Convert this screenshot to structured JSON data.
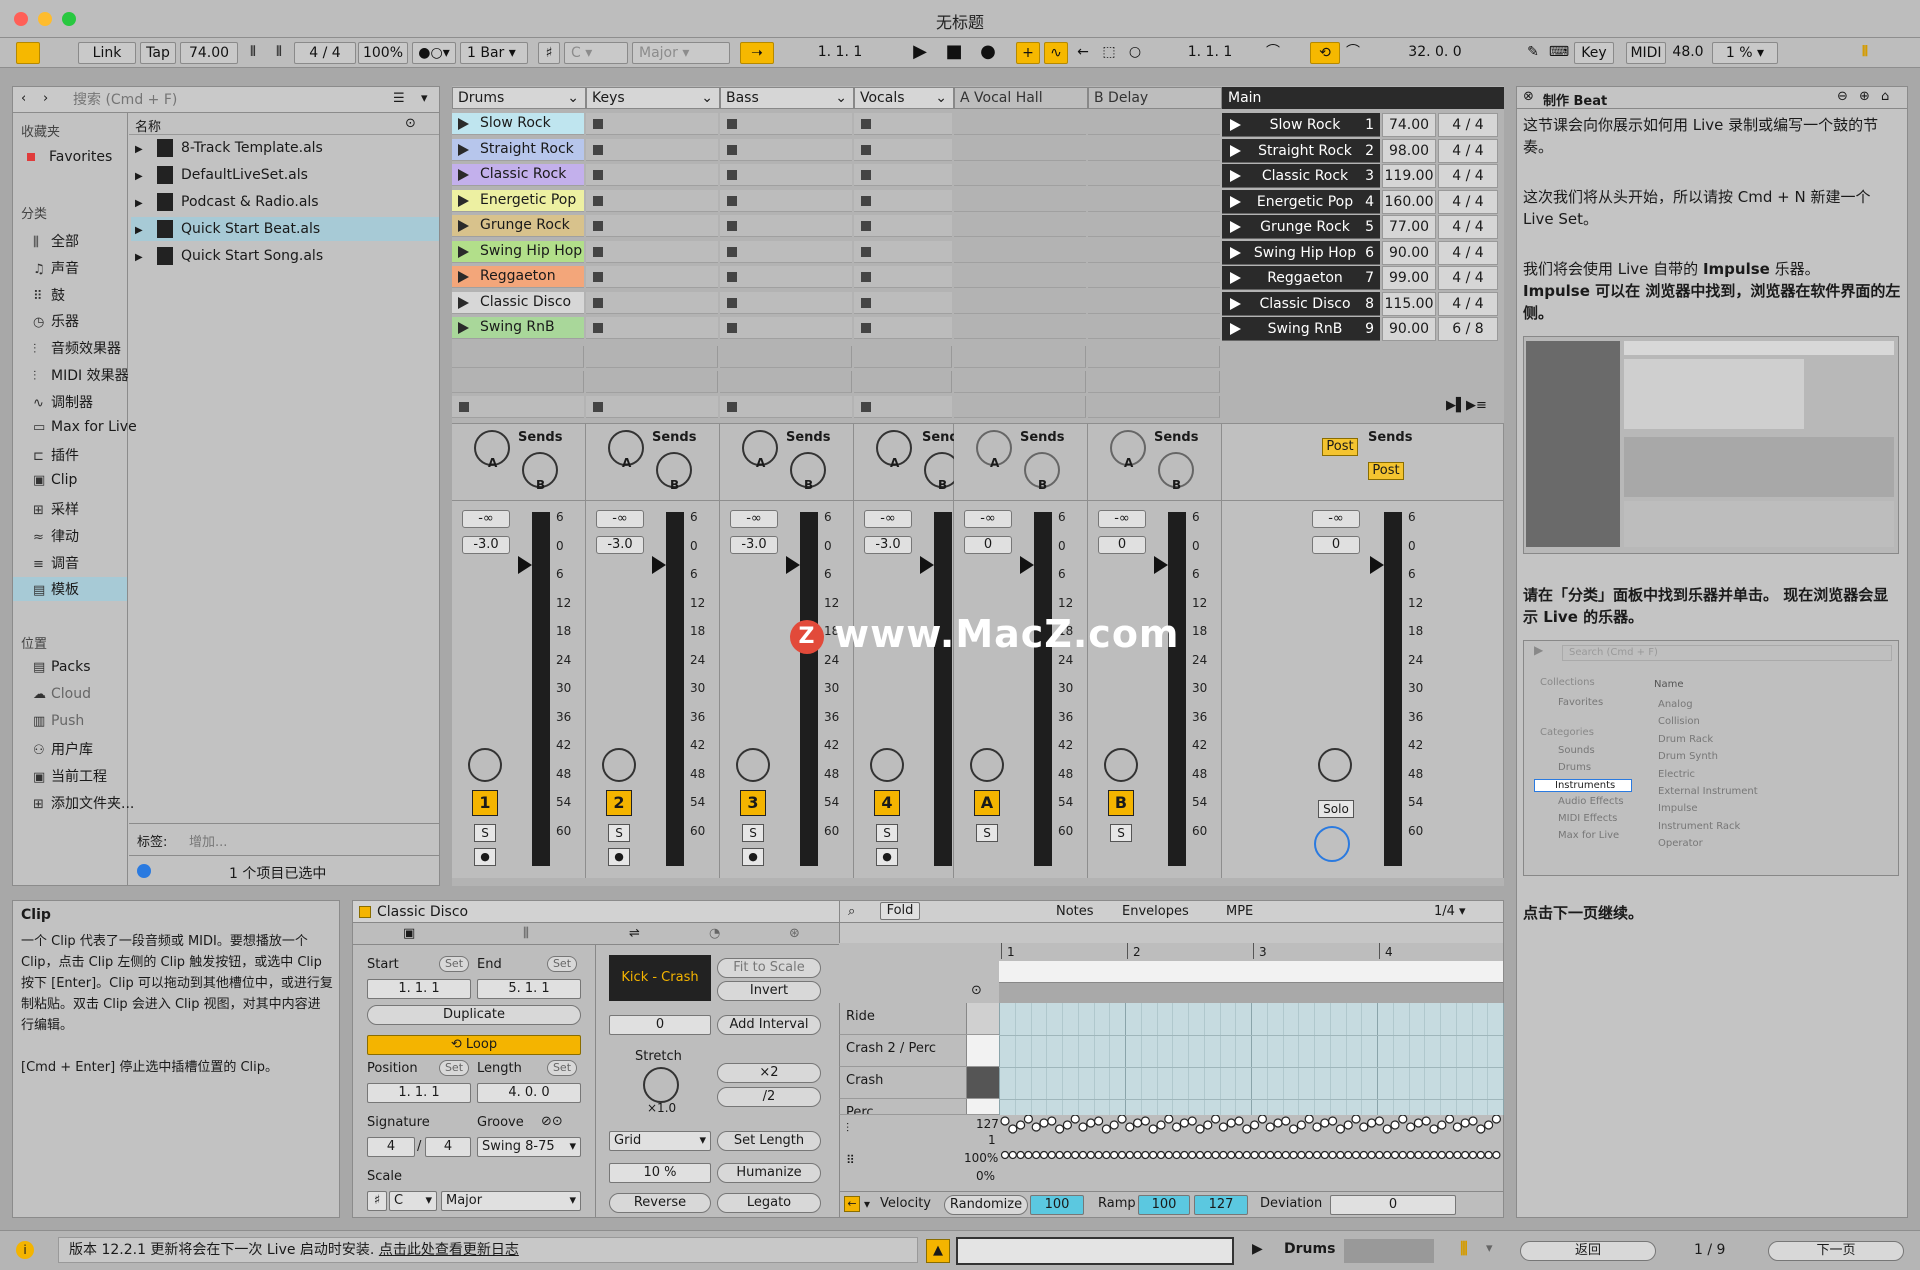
{
  "window": {
    "title": "无标题"
  },
  "toolbar": {
    "link": "Link",
    "tap": "Tap",
    "tempo": "74.00",
    "signature": "4 / 4",
    "zoom": "100%",
    "quantize": "1 Bar",
    "key_root": "C",
    "key_scale": "Major",
    "position": "1.   1.   1",
    "loop_start": "1.   1.   1",
    "loop_length": "32.   0.   0",
    "key_label": "Key",
    "midi_label": "MIDI",
    "sample_rate": "48.0",
    "cpu": "1 %"
  },
  "browser": {
    "search_placeholder": "搜索 (Cmd + F)",
    "favorites_header": "收藏夹",
    "favorites": "Favorites",
    "categories_header": "分类",
    "categories": [
      "全部",
      "声音",
      "鼓",
      "乐器",
      "音频效果器",
      "MIDI 效果器",
      "调制器",
      "Max for Live",
      "插件",
      "Clip",
      "采样",
      "律动",
      "调音",
      "模板"
    ],
    "places_header": "位置",
    "places": [
      "Packs",
      "Cloud",
      "Push",
      "用户库",
      "当前工程",
      "添加文件夹..."
    ],
    "name_header": "名称",
    "files": [
      "8-Track Template.als",
      "DefaultLiveSet.als",
      "Podcast & Radio.als",
      "Quick Start Beat.als",
      "Quick Start Song.als"
    ],
    "tags_label": "标签:",
    "tags_placeholder": "增加...",
    "selection_status": "1 个项目已选中"
  },
  "tracks": [
    {
      "name": "Drums",
      "num": "1",
      "volume": "-3.0"
    },
    {
      "name": "Keys",
      "num": "2",
      "volume": "-3.0"
    },
    {
      "name": "Bass",
      "num": "3",
      "volume": "-3.0"
    },
    {
      "name": "Vocals",
      "num": "4",
      "volume": "-3.0"
    },
    {
      "name": "A Vocal Hall",
      "num": "A",
      "volume": "0"
    },
    {
      "name": "B Delay",
      "num": "B",
      "volume": "0"
    }
  ],
  "main_track": {
    "name": "Main",
    "volume": "0",
    "solo": "Solo"
  },
  "clips": [
    "Slow Rock",
    "Straight Rock",
    "Classic Rock",
    "Energetic Pop",
    "Grunge Rock",
    "Swing Hip Hop",
    "Reggaeton",
    "Classic Disco",
    "Swing RnB"
  ],
  "clip_colors": [
    "#bfe5ef",
    "#b7c6ec",
    "#c3b0ec",
    "#edf0a2",
    "#d8c28c",
    "#b2df8a",
    "#f3a67a",
    "#d7d7d7",
    "#a9d79a"
  ],
  "scenes": [
    {
      "name": "Slow Rock",
      "num": "1",
      "tempo": "74.00",
      "sig": "4 / 4"
    },
    {
      "name": "Straight Rock",
      "num": "2",
      "tempo": "98.00",
      "sig": "4 / 4"
    },
    {
      "name": "Classic Rock",
      "num": "3",
      "tempo": "119.00",
      "sig": "4 / 4"
    },
    {
      "name": "Energetic Pop",
      "num": "4",
      "tempo": "160.00",
      "sig": "4 / 4"
    },
    {
      "name": "Grunge Rock",
      "num": "5",
      "tempo": "77.00",
      "sig": "4 / 4"
    },
    {
      "name": "Swing Hip Hop",
      "num": "6",
      "tempo": "90.00",
      "sig": "4 / 4"
    },
    {
      "name": "Reggaeton",
      "num": "7",
      "tempo": "99.00",
      "sig": "4 / 4"
    },
    {
      "name": "Classic Disco",
      "num": "8",
      "tempo": "115.00",
      "sig": "4 / 4"
    },
    {
      "name": "Swing RnB",
      "num": "9",
      "tempo": "90.00",
      "sig": "6 / 8"
    }
  ],
  "mixer": {
    "sends_label": "Sends",
    "send_a": "A",
    "send_b": "B",
    "post_label": "Post",
    "neg_inf": "-∞",
    "solo_btn": "S",
    "scale": [
      "6",
      "0",
      "6",
      "12",
      "18",
      "24",
      "30",
      "36",
      "42",
      "48",
      "54",
      "60"
    ]
  },
  "info_panel": {
    "title": "Clip",
    "text1": "一个 Clip 代表了一段音频或 MIDI。要想播放一个 Clip，点击 Clip 左侧的 Clip 触发按钮，或选中 Clip 按下 [Enter]。Clip 可以拖动到其他槽位中，或进行复制粘贴。双击 Clip 会进入 Clip 视图，对其中内容进行编辑。",
    "text2": "[Cmd + Enter] 停止选中插槽位置的 Clip。"
  },
  "clip_view": {
    "clip_name": "Classic Disco",
    "start_label": "Start",
    "end_label": "End",
    "set_label": "Set",
    "start_value": "1.   1.   1",
    "end_value": "5.   1.   1",
    "duplicate": "Duplicate",
    "loop": "Loop",
    "position_label": "Position",
    "length_label": "Length",
    "position_value": "1.   1.   1",
    "length_value": "4.   0.   0",
    "signature_label": "Signature",
    "groove_label": "Groove",
    "sig_num": "4",
    "sig_den": "4",
    "groove_value": "Swing 8-75",
    "scale_label": "Scale",
    "scale_root": "C",
    "scale_mode": "Major",
    "pitch_chip": "Kick - Crash",
    "fit_to_scale": "Fit to Scale",
    "invert": "Invert",
    "interval_value": "0",
    "add_interval": "Add Interval",
    "stretch_label": "Stretch",
    "stretch_value": "×1.0",
    "times2": "×2",
    "div2": "/2",
    "grid": "Grid",
    "set_length": "Set Length",
    "humanize_amount": "10 %",
    "humanize": "Humanize",
    "reverse": "Reverse",
    "legato": "Legato"
  },
  "note_editor": {
    "fold": "Fold",
    "tabs": [
      "Notes",
      "Envelopes",
      "MPE"
    ],
    "page": "1/4",
    "bars": [
      "1",
      "2",
      "3",
      "4"
    ],
    "lanes": [
      "Ride",
      "Crash 2 / Perc",
      "Crash",
      "Perc"
    ],
    "vel_max": "127",
    "vel_min": "1",
    "pct_max": "100%",
    "pct_min": "0%",
    "velocity_label": "Velocity",
    "randomize": "Randomize",
    "randomize_value": "100",
    "ramp_label": "Ramp",
    "ramp_from": "100",
    "ramp_to": "127",
    "deviation_label": "Deviation",
    "deviation_value": "0"
  },
  "help": {
    "title": "制作 Beat",
    "p1": "这节课会向你展示如何用 Live 录制或编写一个鼓的节奏。",
    "p2": "这次我们将从头开始，所以请按 Cmd + N 新建一个 Live Set。",
    "p3a": "我们将会使用 Live 自带的 ",
    "p3b": "Impulse",
    "p3c": " 乐器。",
    "p3d": "Impulse 可以在 浏览器中找到，浏览器在软件界面的左侧。",
    "p4": "请在「分类」面板中找到乐器并单击。 现在浏览器会显示 Live 的乐器。",
    "p5": "点击下一页继续。",
    "mini_search": "Search (Cmd + F)",
    "mini_collections": "Collections",
    "mini_favorites": "Favorites",
    "mini_categories": "Categories",
    "mini_cats": [
      "Sounds",
      "Drums",
      "Instruments",
      "Audio Effects",
      "MIDI Effects",
      "Max for Live"
    ],
    "mini_name": "Name",
    "mini_items": [
      "Analog",
      "Collision",
      "Drum Rack",
      "Drum Synth",
      "Electric",
      "External Instrument",
      "Impulse",
      "Instrument Rack",
      "Operator"
    ],
    "back": "返回",
    "page": "1 / 9",
    "next": "下一页"
  },
  "status": {
    "message": "版本 12.2.1 更新将会在下一次 Live 启动时安装.",
    "link": "点击此处查看更新日志",
    "track_name": "Drums"
  },
  "watermark": "www.MacZ.com"
}
